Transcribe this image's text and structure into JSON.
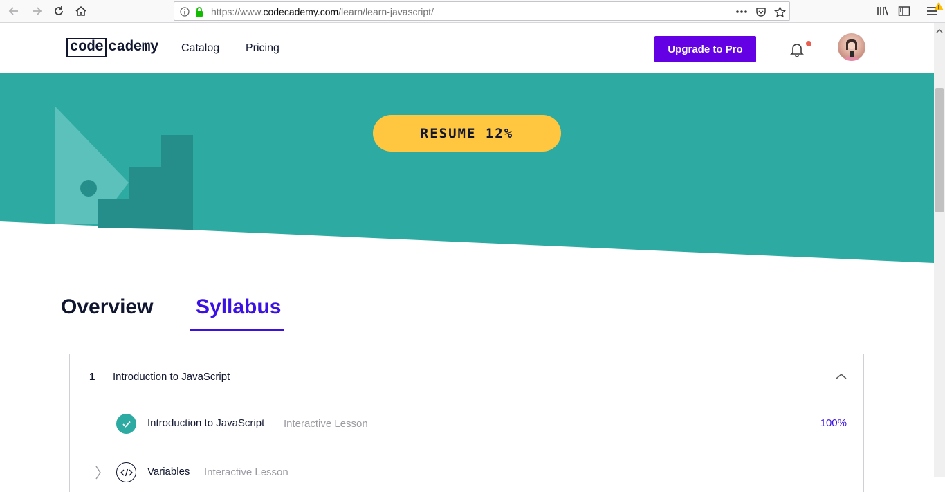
{
  "browser": {
    "url_prefix": "https://www.",
    "url_host": "codecademy.com",
    "url_path": "/learn/learn-javascript/"
  },
  "header": {
    "logo_boxed": "code",
    "logo_rest": "cademy",
    "nav": [
      {
        "label": "Catalog"
      },
      {
        "label": "Pricing"
      }
    ],
    "upgrade_label": "Upgrade to Pro"
  },
  "hero": {
    "resume_label": "RESUME 12%",
    "resume_progress_percent": 12
  },
  "tabs": [
    {
      "label": "Overview",
      "active": false
    },
    {
      "label": "Syllabus",
      "active": true
    }
  ],
  "syllabus": {
    "module": {
      "number": "1",
      "title": "Introduction to JavaScript"
    },
    "lessons": [
      {
        "title": "Introduction to JavaScript",
        "type": "Interactive Lesson",
        "progress": "100%",
        "status": "complete"
      },
      {
        "title": "Variables",
        "type": "Interactive Lesson",
        "progress": "",
        "status": "code"
      }
    ]
  },
  "colors": {
    "brand_purple": "#6400e4",
    "accent_blue": "#3a10e5",
    "hero_teal": "#2daaa2",
    "resume_yellow": "#ffc740",
    "notification_red": "#e85d4d"
  }
}
